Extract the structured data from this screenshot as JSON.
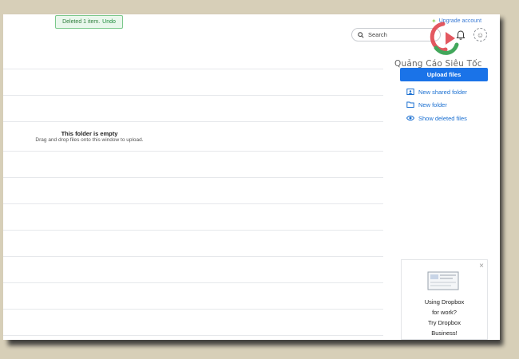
{
  "toast": {
    "message": "Deleted 1 item.",
    "undo_label": "Undo"
  },
  "header": {
    "upgrade_label": "Upgrade account",
    "search_placeholder": "Search",
    "icons": {
      "search": "search-icon",
      "bell": "bell-icon",
      "avatar": "avatar-icon",
      "upgrade": "star-icon"
    }
  },
  "watermark": {
    "text": "Quảng Cáo Siêu Tốc"
  },
  "main": {
    "empty_title": "This folder is empty",
    "empty_subtitle": "Drag and drop files onto this window to upload."
  },
  "sidebar": {
    "upload_label": "Upload files",
    "actions": [
      {
        "label": "New shared folder",
        "icon": "shared-folder-icon"
      },
      {
        "label": "New folder",
        "icon": "folder-icon"
      },
      {
        "label": "Show deleted files",
        "icon": "eye-icon"
      }
    ]
  },
  "promo": {
    "lines": [
      "Using Dropbox",
      "for work?",
      "Try Dropbox",
      "Business!"
    ],
    "close_label": "×"
  },
  "colors": {
    "accent": "#1a73e8",
    "toast_border": "#7bc88b",
    "background": "#d7cfb8"
  }
}
